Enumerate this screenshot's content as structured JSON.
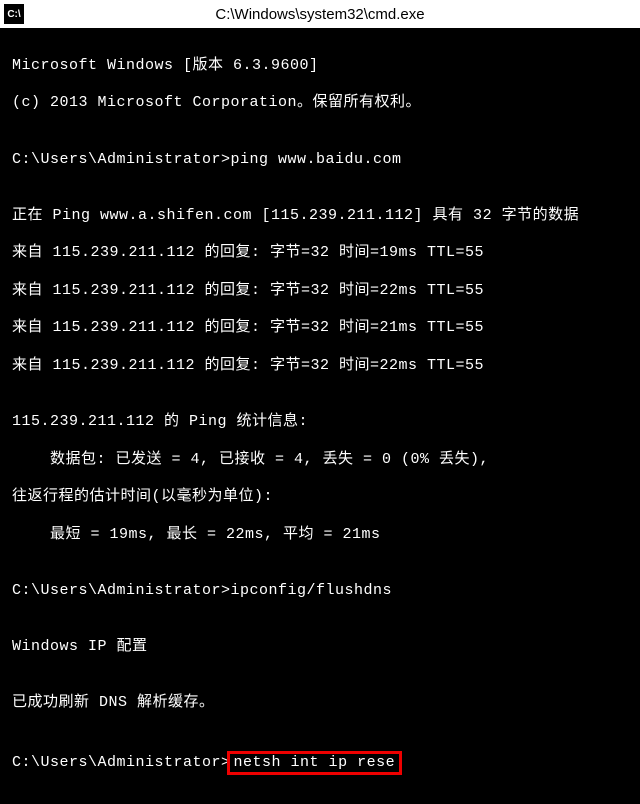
{
  "titlebar": {
    "icon_label": "C:\\",
    "title": "C:\\Windows\\system32\\cmd.exe"
  },
  "terminal": {
    "line1": "Microsoft Windows [版本 6.3.9600]",
    "line2": "(c) 2013 Microsoft Corporation。保留所有权利。",
    "blank1": "",
    "line3": "C:\\Users\\Administrator>ping www.baidu.com",
    "blank2": "",
    "line4": "正在 Ping www.a.shifen.com [115.239.211.112] 具有 32 字节的数据",
    "line5": "来自 115.239.211.112 的回复: 字节=32 时间=19ms TTL=55",
    "line6": "来自 115.239.211.112 的回复: 字节=32 时间=22ms TTL=55",
    "line7": "来自 115.239.211.112 的回复: 字节=32 时间=21ms TTL=55",
    "line8": "来自 115.239.211.112 的回复: 字节=32 时间=22ms TTL=55",
    "blank3": "",
    "line9": "115.239.211.112 的 Ping 统计信息:",
    "line10": "    数据包: 已发送 = 4, 已接收 = 4, 丢失 = 0 (0% 丢失),",
    "line11": "往返行程的估计时间(以毫秒为单位):",
    "line12": "    最短 = 19ms, 最长 = 22ms, 平均 = 21ms",
    "blank4": "",
    "line13": "C:\\Users\\Administrator>ipconfig/flushdns",
    "blank5": "",
    "line14": "Windows IP 配置",
    "blank6": "",
    "line15": "已成功刷新 DNS 解析缓存。",
    "blank7": "",
    "prompt": "C:\\Users\\Administrator>",
    "command": "netsh int ip rese"
  }
}
